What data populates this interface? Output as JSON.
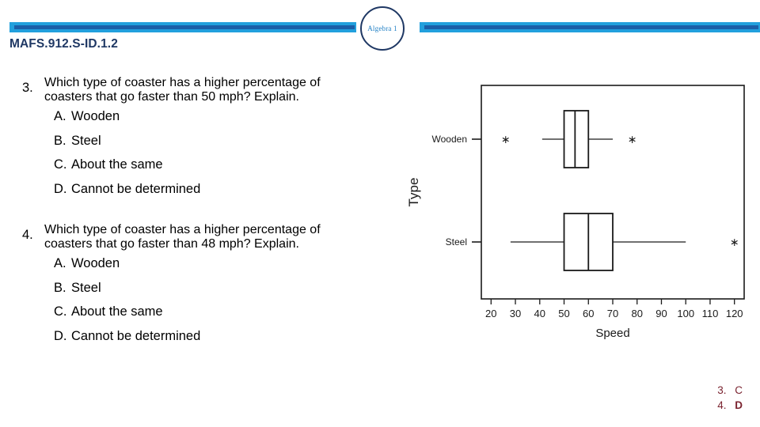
{
  "header": {
    "badge_label": "Algebra 1",
    "standard_code": "MAFS.912.S-ID.1.2"
  },
  "questions": [
    {
      "number": "3.",
      "line1": "Which type of coaster has a higher percentage of",
      "line2": "coasters that go faster than 50 mph?  Explain.",
      "choices": [
        {
          "letter": "A.",
          "text": "Wooden"
        },
        {
          "letter": "B.",
          "text": "Steel"
        },
        {
          "letter": "C.",
          "text": "About the same"
        },
        {
          "letter": "D.",
          "text": "Cannot be determined"
        }
      ]
    },
    {
      "number": "4.",
      "line1": "Which type of coaster has a higher percentage of",
      "line2": "coasters that go faster than 48 mph?  Explain.",
      "choices": [
        {
          "letter": "A.",
          "text": "Wooden"
        },
        {
          "letter": "B.",
          "text": "Steel"
        },
        {
          "letter": "C.",
          "text": "About the same"
        },
        {
          "letter": "D.",
          "text": "Cannot be determined"
        }
      ]
    }
  ],
  "answer_key": [
    {
      "number": "3.",
      "answer": "C"
    },
    {
      "number": "4.",
      "answer": "D"
    }
  ],
  "chart_data": {
    "type": "boxplot",
    "title": "",
    "xlabel": "Speed",
    "ylabel": "Type",
    "xlim": [
      16,
      124
    ],
    "xticks": [
      20,
      30,
      40,
      50,
      60,
      70,
      80,
      90,
      100,
      110,
      120
    ],
    "xtick_labels": [
      "20",
      "30",
      "40",
      "50",
      "60",
      "70",
      "80",
      "90",
      "100",
      "110",
      "120"
    ],
    "categories": [
      "Wooden",
      "Steel"
    ],
    "grid": false,
    "legend": "none",
    "orientation": "horizontal",
    "boxes": [
      {
        "category": "Wooden",
        "whisker_low": 41,
        "q1": 50,
        "median": 54.5,
        "q3": 60,
        "whisker_high": 70,
        "outliers": [
          26,
          78
        ]
      },
      {
        "category": "Steel",
        "whisker_low": 28,
        "q1": 50,
        "median": 60,
        "q3": 70,
        "whisker_high": 100,
        "outliers": [
          120
        ]
      }
    ]
  }
}
